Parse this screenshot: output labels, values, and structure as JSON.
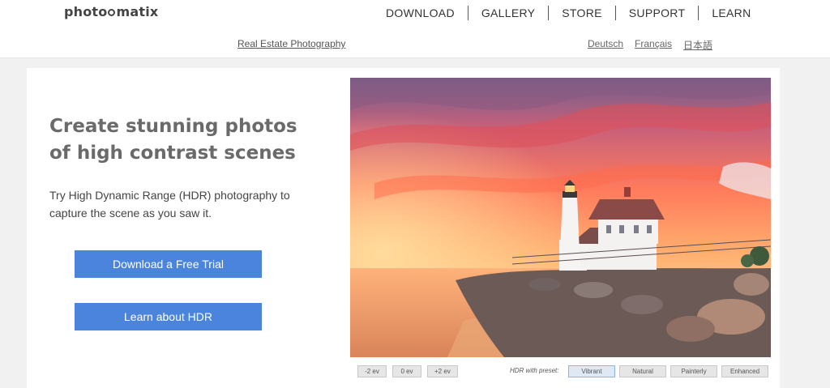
{
  "header": {
    "logo_before": "photo",
    "logo_after": "matix",
    "nav": [
      "DOWNLOAD",
      "GALLERY",
      "STORE",
      "SUPPORT",
      "LEARN"
    ],
    "sublink": "Real Estate Photography",
    "languages": [
      "Deutsch",
      "Français",
      "日本語"
    ]
  },
  "hero": {
    "headline": "Create stunning photos of high contrast scenes",
    "subtext": "Try High Dynamic Range (HDR) photography to capture the scene as you saw it.",
    "trial_button": "Download a Free Trial",
    "learn_button": "Learn about HDR"
  },
  "photo": {
    "subject": "lighthouse at sunset on a rocky shore",
    "colors": {
      "sky_top": "#6a5e8a",
      "sky_mid": "#ff7a5a",
      "sky_glow": "#ffb070",
      "water": "#f0a46e",
      "rocks": "#5d4f4a"
    }
  },
  "controls": {
    "ev_buttons": [
      "-2 ev",
      "0 ev",
      "+2 ev"
    ],
    "preset_label": "HDR with preset:",
    "presets": [
      "Vibrant",
      "Natural",
      "Painterly",
      "Enhanced"
    ],
    "active_preset": "Vibrant"
  },
  "colors": {
    "accent": "#4a84dc",
    "page_bg": "#f1f1f1",
    "heading": "#6a6a6a"
  }
}
